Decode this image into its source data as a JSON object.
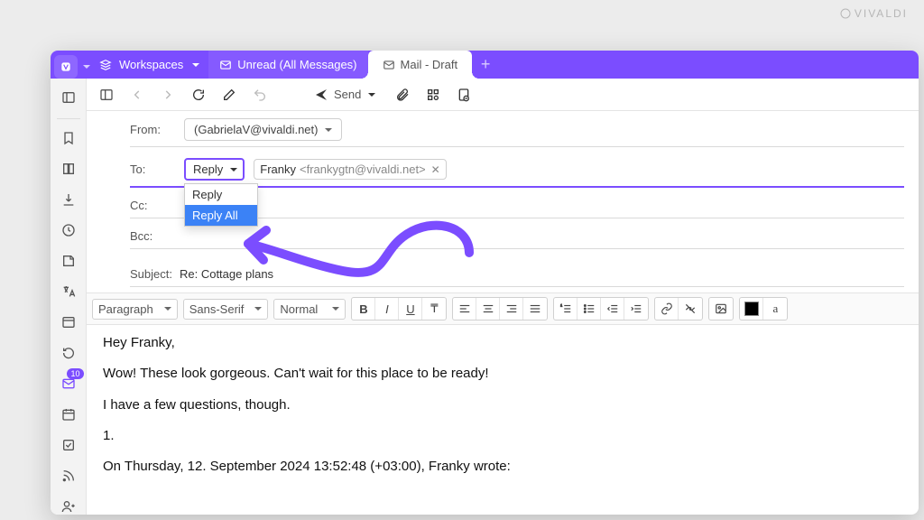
{
  "brand": "VIVALDI",
  "titlebar": {
    "workspaces": "Workspaces",
    "tab_unread": "Unread (All Messages)",
    "tab_active": "Mail - Draft"
  },
  "toolbar": {
    "send": "Send"
  },
  "compose": {
    "from_label": "From:",
    "from_value": "(GabrielaV@vivaldi.net)",
    "to_label": "To:",
    "reply_mode": "Reply",
    "reply_options": {
      "reply": "Reply",
      "reply_all": "Reply All"
    },
    "recipient_name": "Franky",
    "recipient_email": "<frankygtn@vivaldi.net>",
    "cc_label": "Cc:",
    "bcc_label": "Bcc:",
    "subject_label": "Subject:",
    "subject_value": "Re: Cottage plans"
  },
  "format": {
    "paragraph": "Paragraph",
    "font": "Sans-Serif",
    "size": "Normal"
  },
  "body": {
    "p1": "Hey Franky,",
    "p2": "Wow! These look gorgeous. Can't wait for this place to be ready!",
    "p3": "I have a few questions, though.",
    "p4": "1.",
    "p5": "On Thursday, 12. September 2024 13:52:48 (+03:00), Franky wrote:"
  },
  "sidebar": {
    "mail_badge": "10"
  }
}
